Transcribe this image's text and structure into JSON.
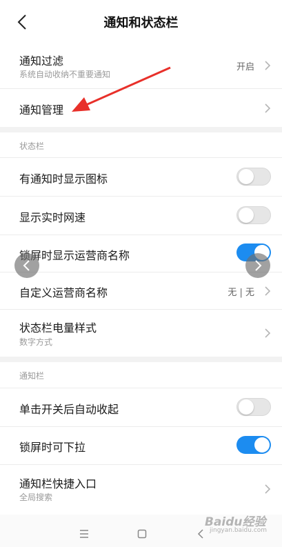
{
  "header": {
    "title": "通知和状态栏"
  },
  "general": {
    "notification_filter": {
      "title": "通知过滤",
      "subtitle": "系统自动收纳不重要通知",
      "value": "开启"
    },
    "notification_management": {
      "title": "通知管理"
    }
  },
  "status_bar": {
    "label": "状态栏",
    "show_icon": {
      "title": "有通知时显示图标",
      "on": false
    },
    "show_speed": {
      "title": "显示实时网速",
      "on": false
    },
    "lock_carrier": {
      "title": "锁屏时显示运营商名称",
      "on": true
    },
    "custom_carrier": {
      "title": "自定义运营商名称",
      "value": "无 | 无"
    },
    "battery_style": {
      "title": "状态栏电量样式",
      "subtitle": "数字方式"
    }
  },
  "notification_bar": {
    "label": "通知栏",
    "auto_collapse": {
      "title": "单击开关后自动收起",
      "on": false
    },
    "pull_down_locked": {
      "title": "锁屏时可下拉",
      "on": true
    },
    "quick_entry": {
      "title": "通知栏快捷入口",
      "subtitle": "全局搜索"
    }
  },
  "watermark": {
    "text": "Baidu经验",
    "sub": "jingyan.baidu.com"
  },
  "colors": {
    "accent": "#1c8cf0",
    "annotation_arrow": "#e8302a"
  }
}
